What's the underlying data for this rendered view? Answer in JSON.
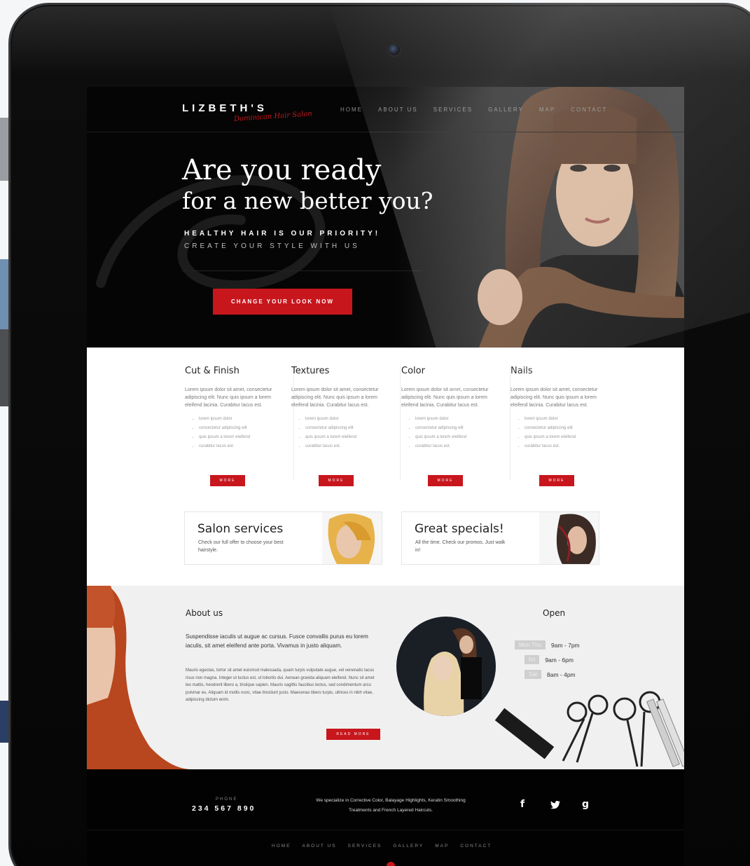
{
  "brand": {
    "name": "LIZBETH'S",
    "tagline": "Dominican Hair Salon"
  },
  "nav": {
    "items": [
      "HOME",
      "ABOUT US",
      "SERVICES",
      "GALLERY",
      "MAP",
      "CONTACT"
    ]
  },
  "hero": {
    "title_line1": "Are you ready",
    "title_line2": "for a new better you?",
    "sub1": "HEALTHY HAIR IS OUR PRIORITY!",
    "sub2": "CREATE YOUR STYLE WITH US",
    "cta": "CHANGE YOUR LOOK NOW"
  },
  "services": [
    {
      "title": "Cut & Finish",
      "text": "Lorem ipsum dolor sit amet, consectetur adipiscing elit. Nunc quis ipsum a lorem eleifend lacinia. Curabitur lacus est.",
      "bullets": [
        "lorem ipsum dolor",
        "consectetur adipiscing elit",
        "quis ipsum a lorem eleifend",
        "curabitur lacus est."
      ],
      "more": "MORE"
    },
    {
      "title": "Textures",
      "text": "Lorem ipsum dolor sit amet, consectetur adipiscing elit. Nunc quis ipsum a lorem eleifend lacinia. Curabitur lacus est.",
      "bullets": [
        "lorem ipsum dolor",
        "consectetur adipiscing elit",
        "quis ipsum a lorem eleifend",
        "curabitur lacus est."
      ],
      "more": "MORE"
    },
    {
      "title": "Color",
      "text": "Lorem ipsum dolor sit amet, consectetur adipiscing elit. Nunc quis ipsum a lorem eleifend lacinia. Curabitur lacus est.",
      "bullets": [
        "lorem ipsum dolor",
        "consectetur adipiscing elit",
        "quis ipsum a lorem eleifend",
        "curabitur lacus est."
      ],
      "more": "MORE"
    },
    {
      "title": "Nails",
      "text": "Lorem ipsum dolor sit amet, consectetur adipiscing elit. Nunc quis ipsum a lorem eleifend lacinia. Curabitur lacus est.",
      "bullets": [
        "lorem ipsum dolor",
        "consectetur adipiscing elit",
        "quis ipsum a lorem eleifend",
        "curabitur lacus est."
      ],
      "more": "MORE"
    }
  ],
  "promos": [
    {
      "title": "Salon services",
      "text": "Check our full offer to choose your best hairstyle."
    },
    {
      "title": "Great specials!",
      "text": "All the time. Check our promos. Just walk in!"
    }
  ],
  "about": {
    "title": "About us",
    "lead": "Suspendisse iaculis ut augue ac cursus. Fusce convallis purus eu lorem iaculis, sit amet eleifend ante porta. Vivamus in justo aliquam.",
    "body": "Mauris egestas, tortor sit amet euismod malesuada, quam turpis vulputate augue, vel venenatis lacus risus non magna. Integer ut luctus est, ut lobortis dui. Aenean gravida aliquam eleifend. Nunc sit amet leo mattis, hendrerit libero a, tristique sapien. Mauris sagittis faucibus lectus, sed condimentum arcu pulvinar eu. Aliquam id mollis nunc, vitae tincidunt justo. Maecenas libero turpis, ultrices in nibh vitae, adipiscing dictum enim.",
    "more": "READ MORE"
  },
  "open": {
    "title": "Open",
    "hours": [
      {
        "day": "Mon-Thu",
        "time": "9am - 7pm"
      },
      {
        "day": "Fri",
        "time": "9am - 6pm"
      },
      {
        "day": "Sat",
        "time": "8am - 4pm"
      }
    ]
  },
  "footer": {
    "phone_label": "PHONE",
    "phone": "234 567 890",
    "text": "We specialize in Corrective Color, Balayage Highlights, Keratin Smoothing Treatments and French Layered Haircuts.",
    "social": [
      "f",
      "twitter-icon",
      "g"
    ],
    "nav": [
      "HOME",
      "ABOUT US",
      "SERVICES",
      "GALLERY",
      "MAP",
      "CONTACT"
    ]
  },
  "colors": {
    "accent": "#c8161d",
    "dark": "#050505",
    "light": "#f0f0f0"
  }
}
